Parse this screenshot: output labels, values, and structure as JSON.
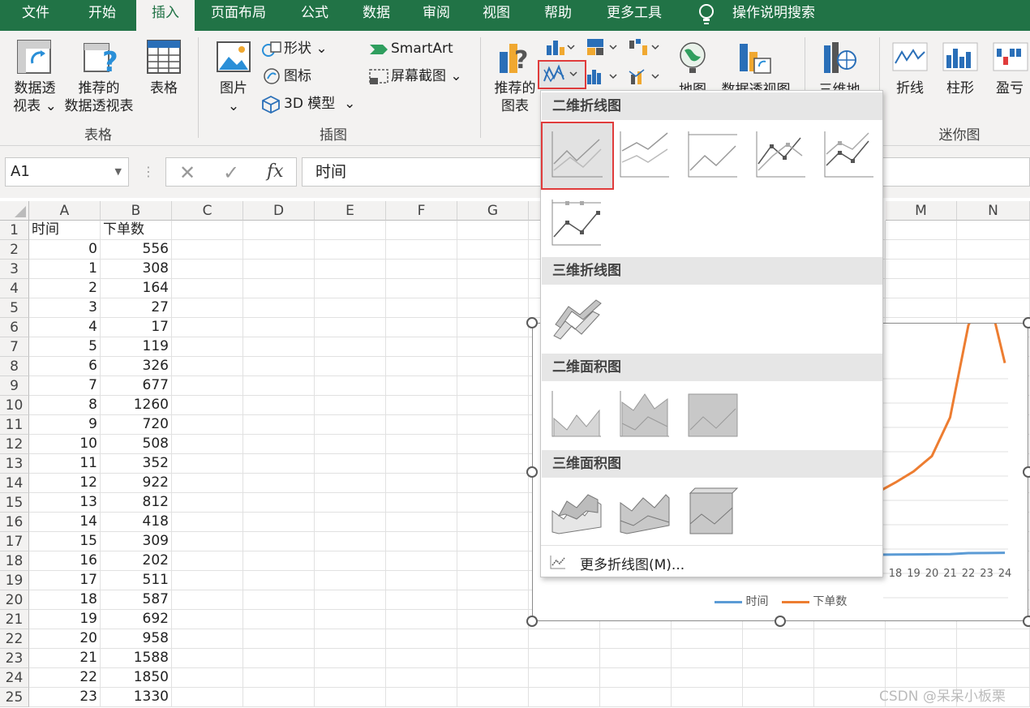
{
  "tabs": [
    "文件",
    "开始",
    "插入",
    "页面布局",
    "公式",
    "数据",
    "审阅",
    "视图",
    "帮助",
    "更多工具",
    "操作说明搜索"
  ],
  "ribbon": {
    "pivot": [
      "数据透",
      "视表"
    ],
    "recommended_pivot": [
      "推荐的",
      "数据透视表"
    ],
    "table": "表格",
    "group_tables": "表格",
    "picture": "图片",
    "shapes": "形状",
    "icons": "图标",
    "model3d": "3D 模型",
    "smartart": "SmartArt",
    "screenshot": "屏幕截图",
    "group_illustrations": "插图",
    "recommended_charts": [
      "推荐的",
      "图表"
    ],
    "map": "地图",
    "pivot_chart": "数据透视图",
    "three_d_map": "三维地",
    "spark_line": "折线",
    "spark_column": "柱形",
    "spark_winloss": "盈亏",
    "group_sparklines": "迷你图"
  },
  "formula_bar": {
    "name_box": "A1",
    "content": "时间",
    "fx": "fx"
  },
  "columns": [
    "A",
    "B",
    "C",
    "D",
    "E",
    "F",
    "G",
    "M",
    "N"
  ],
  "rows": [
    {
      "n": "1",
      "a": "时间",
      "b": "下单数"
    },
    {
      "n": "2",
      "a": "0",
      "b": "556"
    },
    {
      "n": "3",
      "a": "1",
      "b": "308"
    },
    {
      "n": "4",
      "a": "2",
      "b": "164"
    },
    {
      "n": "5",
      "a": "3",
      "b": "27"
    },
    {
      "n": "6",
      "a": "4",
      "b": "17"
    },
    {
      "n": "7",
      "a": "5",
      "b": "119"
    },
    {
      "n": "8",
      "a": "6",
      "b": "326"
    },
    {
      "n": "9",
      "a": "7",
      "b": "677"
    },
    {
      "n": "10",
      "a": "8",
      "b": "1260"
    },
    {
      "n": "11",
      "a": "9",
      "b": "720"
    },
    {
      "n": "12",
      "a": "10",
      "b": "508"
    },
    {
      "n": "13",
      "a": "11",
      "b": "352"
    },
    {
      "n": "14",
      "a": "12",
      "b": "922"
    },
    {
      "n": "15",
      "a": "13",
      "b": "812"
    },
    {
      "n": "16",
      "a": "14",
      "b": "418"
    },
    {
      "n": "17",
      "a": "15",
      "b": "309"
    },
    {
      "n": "18",
      "a": "16",
      "b": "202"
    },
    {
      "n": "19",
      "a": "17",
      "b": "511"
    },
    {
      "n": "20",
      "a": "18",
      "b": "587"
    },
    {
      "n": "21",
      "a": "19",
      "b": "692"
    },
    {
      "n": "22",
      "a": "20",
      "b": "958"
    },
    {
      "n": "23",
      "a": "21",
      "b": "1588"
    },
    {
      "n": "24",
      "a": "22",
      "b": "1850"
    },
    {
      "n": "25",
      "a": "23",
      "b": "1330"
    }
  ],
  "menu": {
    "h1": "二维折线图",
    "h2": "三维折线图",
    "h3": "二维面积图",
    "h4": "三维面积图",
    "more": "更多折线图(M)..."
  },
  "chart": {
    "x_ticks": [
      "18",
      "19",
      "20",
      "21",
      "22",
      "23",
      "24"
    ],
    "legend": [
      "时间",
      "下单数"
    ]
  },
  "colors": {
    "excel_green": "#217346",
    "series_time": "#5b9bd5",
    "series_orders": "#ed7d31",
    "highlight": "#e03c3c"
  },
  "watermark": "CSDN @呆呆小板栗"
}
